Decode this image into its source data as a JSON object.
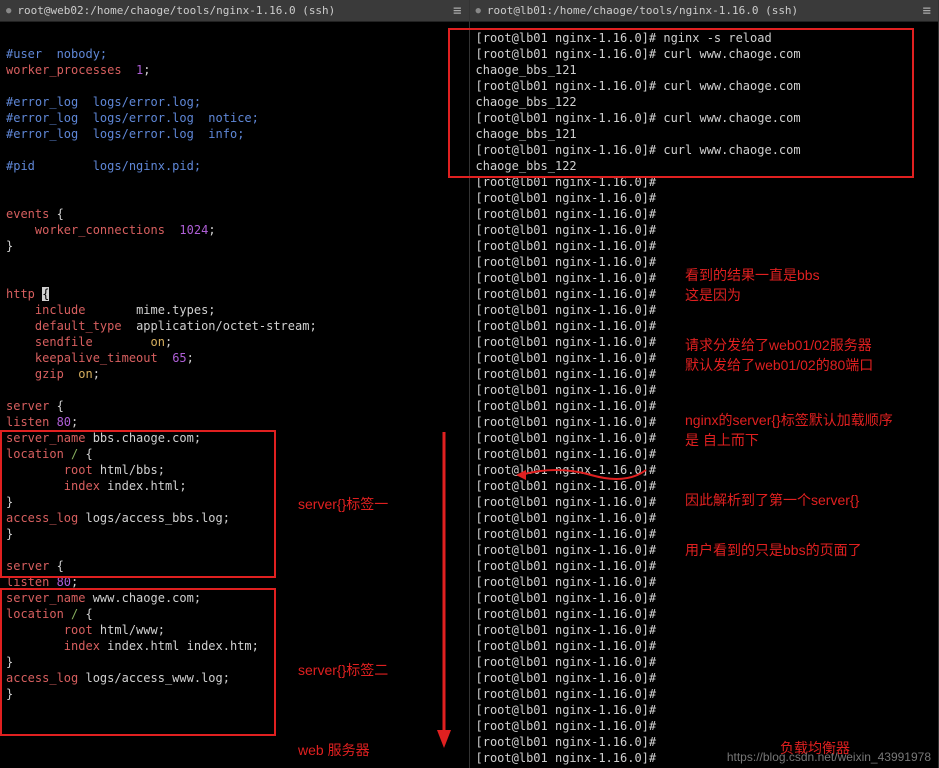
{
  "left": {
    "title": "root@web02:/home/chaoge/tools/nginx-1.16.0 (ssh)",
    "config_lines": [
      {
        "segs": [
          [
            "",
            ""
          ]
        ]
      },
      {
        "segs": [
          [
            "c-comment",
            "#user  nobody;"
          ]
        ]
      },
      {
        "segs": [
          [
            "c-key",
            "worker_processes  "
          ],
          [
            "c-num",
            "1"
          ],
          [
            "c-white",
            ";"
          ]
        ]
      },
      {
        "segs": [
          [
            "",
            ""
          ]
        ]
      },
      {
        "segs": [
          [
            "c-comment",
            "#error_log  logs/error.log;"
          ]
        ]
      },
      {
        "segs": [
          [
            "c-comment",
            "#error_log  logs/error.log  notice;"
          ]
        ]
      },
      {
        "segs": [
          [
            "c-comment",
            "#error_log  logs/error.log  info;"
          ]
        ]
      },
      {
        "segs": [
          [
            "",
            ""
          ]
        ]
      },
      {
        "segs": [
          [
            "c-comment",
            "#pid        logs/nginx.pid;"
          ]
        ]
      },
      {
        "segs": [
          [
            "",
            ""
          ]
        ]
      },
      {
        "segs": [
          [
            "",
            ""
          ]
        ]
      },
      {
        "segs": [
          [
            "c-key",
            "events"
          ],
          [
            "c-white",
            " {"
          ]
        ]
      },
      {
        "segs": [
          [
            "c-white",
            "    "
          ],
          [
            "c-key",
            "worker_connections  "
          ],
          [
            "c-num",
            "1024"
          ],
          [
            "c-white",
            ";"
          ]
        ]
      },
      {
        "segs": [
          [
            "c-white",
            "}"
          ]
        ]
      },
      {
        "segs": [
          [
            "",
            ""
          ]
        ]
      },
      {
        "segs": [
          [
            "",
            ""
          ]
        ]
      },
      {
        "segs": [
          [
            "c-key",
            "http"
          ],
          [
            "c-white",
            " "
          ],
          [
            "c-reverse",
            "{"
          ]
        ]
      },
      {
        "segs": [
          [
            "c-white",
            "    "
          ],
          [
            "c-key",
            "include       "
          ],
          [
            "c-white",
            "mime.types;"
          ]
        ]
      },
      {
        "segs": [
          [
            "c-white",
            "    "
          ],
          [
            "c-key",
            "default_type  "
          ],
          [
            "c-white",
            "application/octet-stream;"
          ]
        ]
      },
      {
        "segs": [
          [
            "c-white",
            "    "
          ],
          [
            "c-key",
            "sendfile        "
          ],
          [
            "c-yellow",
            "on"
          ],
          [
            "c-white",
            ";"
          ]
        ]
      },
      {
        "segs": [
          [
            "c-white",
            "    "
          ],
          [
            "c-key",
            "keepalive_timeout  "
          ],
          [
            "c-num",
            "65"
          ],
          [
            "c-white",
            ";"
          ]
        ]
      },
      {
        "segs": [
          [
            "c-white",
            "    "
          ],
          [
            "c-key",
            "gzip  "
          ],
          [
            "c-yellow",
            "on"
          ],
          [
            "c-white",
            ";"
          ]
        ]
      },
      {
        "segs": [
          [
            "",
            ""
          ]
        ]
      },
      {
        "segs": [
          [
            "c-key",
            "server"
          ],
          [
            "c-white",
            " {"
          ]
        ]
      },
      {
        "segs": [
          [
            "c-key",
            "listen "
          ],
          [
            "c-num",
            "80"
          ],
          [
            "c-white",
            ";"
          ]
        ]
      },
      {
        "segs": [
          [
            "c-key",
            "server_name "
          ],
          [
            "c-white",
            "bbs.chaoge.com;"
          ]
        ]
      },
      {
        "segs": [
          [
            "c-key",
            "location "
          ],
          [
            "c-val",
            "/ "
          ],
          [
            "c-white",
            "{"
          ]
        ]
      },
      {
        "segs": [
          [
            "c-white",
            "        "
          ],
          [
            "c-key",
            "root "
          ],
          [
            "c-white",
            "html/bbs;"
          ]
        ]
      },
      {
        "segs": [
          [
            "c-white",
            "        "
          ],
          [
            "c-key",
            "index "
          ],
          [
            "c-white",
            "index.html;"
          ]
        ]
      },
      {
        "segs": [
          [
            "c-white",
            "}"
          ]
        ]
      },
      {
        "segs": [
          [
            "c-key",
            "access_log "
          ],
          [
            "c-white",
            "logs/access_bbs.log;"
          ]
        ]
      },
      {
        "segs": [
          [
            "c-white",
            "}"
          ]
        ]
      },
      {
        "segs": [
          [
            "",
            ""
          ]
        ]
      },
      {
        "segs": [
          [
            "c-key",
            "server"
          ],
          [
            "c-white",
            " {"
          ]
        ]
      },
      {
        "segs": [
          [
            "c-key",
            "listen "
          ],
          [
            "c-num",
            "80"
          ],
          [
            "c-white",
            ";"
          ]
        ]
      },
      {
        "segs": [
          [
            "c-key",
            "server_name "
          ],
          [
            "c-white",
            "www.chaoge.com;"
          ]
        ]
      },
      {
        "segs": [
          [
            "c-key",
            "location "
          ],
          [
            "c-val",
            "/ "
          ],
          [
            "c-white",
            "{"
          ]
        ]
      },
      {
        "segs": [
          [
            "c-white",
            "        "
          ],
          [
            "c-key",
            "root "
          ],
          [
            "c-white",
            "html/www;"
          ]
        ]
      },
      {
        "segs": [
          [
            "c-white",
            "        "
          ],
          [
            "c-key",
            "index "
          ],
          [
            "c-white",
            "index.html index.htm;"
          ]
        ]
      },
      {
        "segs": [
          [
            "c-white",
            "}"
          ]
        ]
      },
      {
        "segs": [
          [
            "c-key",
            "access_log "
          ],
          [
            "c-white",
            "logs/access_www.log;"
          ]
        ]
      },
      {
        "segs": [
          [
            "c-white",
            "}"
          ]
        ]
      }
    ]
  },
  "right": {
    "title": "root@lb01:/home/chaoge/tools/nginx-1.16.0 (ssh)",
    "lines": [
      "[root@lb01 nginx-1.16.0]# nginx -s reload",
      "[root@lb01 nginx-1.16.0]# curl www.chaoge.com",
      "chaoge_bbs_121",
      "[root@lb01 nginx-1.16.0]# curl www.chaoge.com",
      "chaoge_bbs_122",
      "[root@lb01 nginx-1.16.0]# curl www.chaoge.com",
      "chaoge_bbs_121",
      "[root@lb01 nginx-1.16.0]# curl www.chaoge.com",
      "chaoge_bbs_122",
      "[root@lb01 nginx-1.16.0]#",
      "[root@lb01 nginx-1.16.0]#",
      "[root@lb01 nginx-1.16.0]#",
      "[root@lb01 nginx-1.16.0]#",
      "[root@lb01 nginx-1.16.0]#",
      "[root@lb01 nginx-1.16.0]#",
      "[root@lb01 nginx-1.16.0]#",
      "[root@lb01 nginx-1.16.0]#",
      "[root@lb01 nginx-1.16.0]#",
      "[root@lb01 nginx-1.16.0]#",
      "[root@lb01 nginx-1.16.0]#",
      "[root@lb01 nginx-1.16.0]#",
      "[root@lb01 nginx-1.16.0]#",
      "[root@lb01 nginx-1.16.0]#",
      "[root@lb01 nginx-1.16.0]#",
      "[root@lb01 nginx-1.16.0]#",
      "[root@lb01 nginx-1.16.0]#",
      "[root@lb01 nginx-1.16.0]#",
      "[root@lb01 nginx-1.16.0]#",
      "[root@lb01 nginx-1.16.0]#",
      "[root@lb01 nginx-1.16.0]#",
      "[root@lb01 nginx-1.16.0]#",
      "[root@lb01 nginx-1.16.0]#",
      "[root@lb01 nginx-1.16.0]#",
      "[root@lb01 nginx-1.16.0]#",
      "[root@lb01 nginx-1.16.0]#",
      "[root@lb01 nginx-1.16.0]#",
      "[root@lb01 nginx-1.16.0]#",
      "[root@lb01 nginx-1.16.0]#",
      "[root@lb01 nginx-1.16.0]#",
      "[root@lb01 nginx-1.16.0]#",
      "[root@lb01 nginx-1.16.0]#",
      "[root@lb01 nginx-1.16.0]#",
      "[root@lb01 nginx-1.16.0]#",
      "[root@lb01 nginx-1.16.0]#",
      "[root@lb01 nginx-1.16.0]#",
      "[root@lb01 nginx-1.16.0]#"
    ]
  },
  "annotations": {
    "label1": "server{}标签一",
    "label2": "server{}标签二",
    "web_server": "web 服务器",
    "lb_server": "负载均衡器",
    "note1a": "看到的结果一直是bbs",
    "note1b": "这是因为",
    "note2a": "请求分发给了web01/02服务器",
    "note2b": "默认发给了web01/02的80端口",
    "note3a": "nginx的server{}标签默认加载顺序",
    "note3b": "是 自上而下",
    "note4": "因此解析到了第一个server{}",
    "note5": "用户看到的只是bbs的页面了"
  },
  "watermark": "https://blog.csdn.net/weixin_43991978"
}
